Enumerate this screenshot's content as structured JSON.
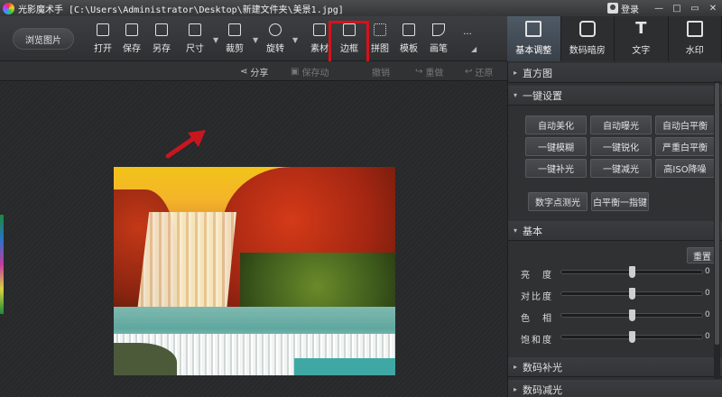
{
  "titlebar": {
    "app_name": "光影魔术手",
    "path": "[C:\\Users\\Administrator\\Desktop\\新建文件夹\\美景1.jpg]",
    "login": "登录",
    "window_buttons": [
      "—",
      "□",
      "▭",
      "✕"
    ]
  },
  "toolbar": {
    "browse": "浏览图片",
    "tools": [
      {
        "label": "打开",
        "icon": "open-icon"
      },
      {
        "label": "保存",
        "icon": "save-icon"
      },
      {
        "label": "另存",
        "icon": "save-as-icon"
      },
      {
        "label": "尺寸",
        "icon": "resize-icon"
      },
      {
        "label": "裁剪",
        "icon": "crop-icon"
      },
      {
        "label": "旋转",
        "icon": "rotate-icon"
      },
      {
        "label": "素材",
        "icon": "star-icon"
      },
      {
        "label": "边框",
        "icon": "frame-icon"
      },
      {
        "label": "拼图",
        "icon": "grid-icon"
      },
      {
        "label": "模板",
        "icon": "printer-icon"
      },
      {
        "label": "画笔",
        "icon": "brush-icon"
      },
      {
        "label": "...",
        "icon": "more-icon"
      }
    ]
  },
  "subbar": {
    "share": "分享",
    "save_as_web": "保存动",
    "undo": "撤销",
    "redo": "重做",
    "restore": "还原"
  },
  "right_tabs": [
    {
      "label": "基本调整",
      "icon": "adjust-icon",
      "active": true
    },
    {
      "label": "数码暗房",
      "icon": "camera-icon",
      "active": false
    },
    {
      "label": "文字",
      "icon": "text-icon",
      "active": false
    },
    {
      "label": "水印",
      "icon": "watermark-icon",
      "active": false
    }
  ],
  "panel": {
    "histogram": "直方图",
    "one_click": "一键设置",
    "buttons": [
      "自动美化",
      "自动曝光",
      "自动白平衡",
      "一键模糊",
      "一键锐化",
      "严重白平衡",
      "一键补光",
      "一键减光",
      "高ISO降噪"
    ],
    "buttons2": [
      "数字点测光",
      "白平衡一指键"
    ],
    "basic": "基本",
    "reset": "重置",
    "sliders": [
      {
        "label": "亮　度",
        "value": 0,
        "position": 0.5
      },
      {
        "label": "对比度",
        "value": 0,
        "position": 0.5
      },
      {
        "label": "色　相",
        "value": 0,
        "position": 0.5
      },
      {
        "label": "饱和度",
        "value": 0,
        "position": 0.5
      }
    ],
    "digital_fill": "数码补光",
    "digital_reduce": "数码减光"
  },
  "colors": {
    "highlight": "#d6121b",
    "arrow": "#c8161e",
    "active_tab": "#45505b"
  }
}
